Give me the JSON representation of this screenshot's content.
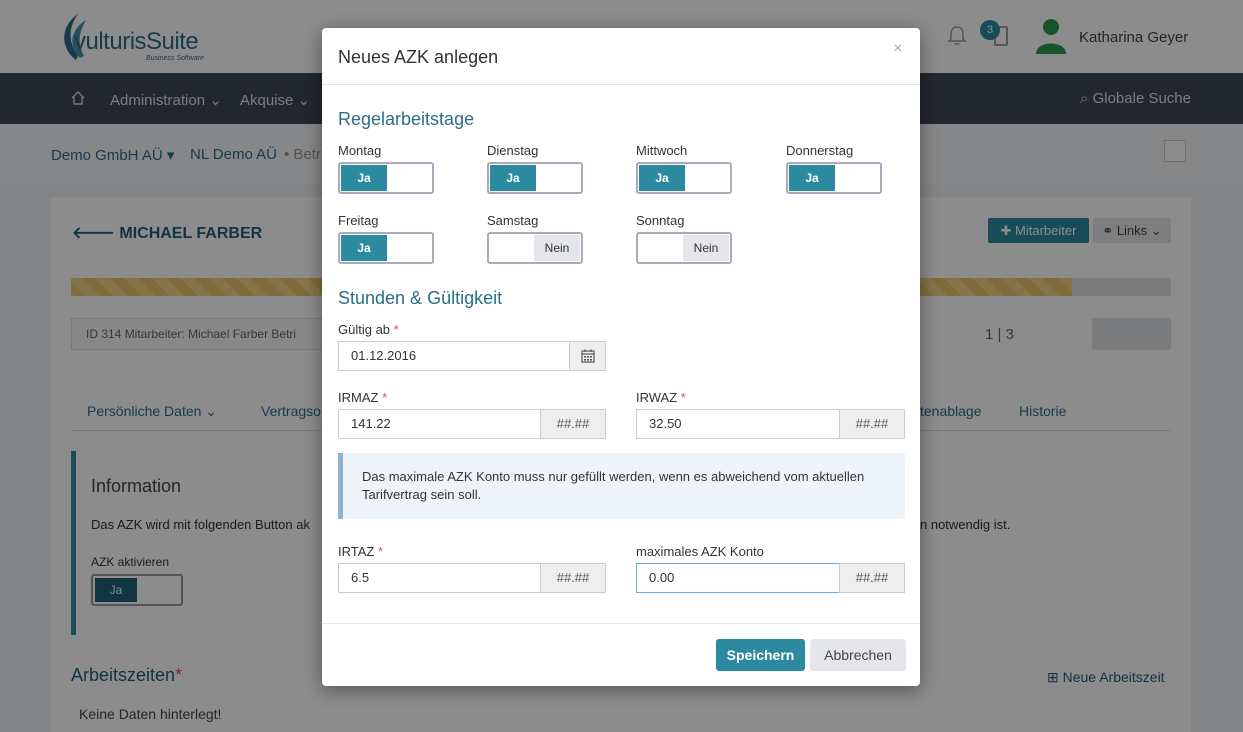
{
  "app": {
    "logo_text": "vulturisSuite",
    "logo_subtitle": "Business Software",
    "notification_count": "3",
    "user_name": "Katharina Geyer",
    "brand_color": "#2b8aa0"
  },
  "nav": {
    "items": [
      "Administration",
      "Akquise"
    ],
    "search_label": "Globale Suche"
  },
  "breadcrumb": {
    "company": "Demo GmbH AÜ",
    "branch": "NL Demo AÜ",
    "partial": "Betr"
  },
  "employee": {
    "title": "MICHAEL FARBER",
    "btn_mitarbeiter": "Mitarbeiter",
    "btn_links": "Links",
    "progress_fraction": 0.91,
    "id_strip": "ID 314 Mitarbeiter: Michael Farber Betri",
    "pager": "1 | 3"
  },
  "tabs": [
    "Persönliche Daten",
    "Vertragso",
    "tenablage",
    "Historie"
  ],
  "info": {
    "title": "Information",
    "text_left": "Das AZK wird mit folgenden Button ak",
    "text_right": "n notwendig ist.",
    "azk_label": "AZK aktivieren",
    "azk_value": "Ja"
  },
  "arbeitszeiten": {
    "title": "Arbeitszeiten",
    "add_label": "Neue Arbeitszeit",
    "empty": "Keine Daten hinterlegt!"
  },
  "modal": {
    "title": "Neues AZK anlegen",
    "close": "×",
    "section_days": "Regelarbeitstage",
    "days": [
      {
        "label": "Montag",
        "on": true,
        "on_text": "Ja",
        "off_text": ""
      },
      {
        "label": "Dienstag",
        "on": true,
        "on_text": "Ja",
        "off_text": ""
      },
      {
        "label": "Mittwoch",
        "on": true,
        "on_text": "Ja",
        "off_text": ""
      },
      {
        "label": "Donnerstag",
        "on": true,
        "on_text": "Ja",
        "off_text": ""
      },
      {
        "label": "Freitag",
        "on": true,
        "on_text": "Ja",
        "off_text": ""
      },
      {
        "label": "Samstag",
        "on": false,
        "on_text": "",
        "off_text": "Nein"
      },
      {
        "label": "Sonntag",
        "on": false,
        "on_text": "",
        "off_text": "Nein"
      }
    ],
    "section_hours": "Stunden & Gültigkeit",
    "gueltig_label": "Gültig ab",
    "gueltig_value": "01.12.2016",
    "irmaz_label": "IRMAZ",
    "irmaz_value": "141.22",
    "irwaz_label": "IRWAZ",
    "irwaz_value": "32.50",
    "addon": "##.##",
    "alert": "Das maximale AZK Konto muss nur gefüllt werden, wenn es abweichend vom aktuellen Tarifvertrag sein soll.",
    "irtaz_label": "IRTAZ",
    "irtaz_value": "6.5",
    "max_label": "maximales AZK Konto",
    "max_value": "0.00",
    "required_mark": "*",
    "save": "Speichern",
    "cancel": "Abbrechen"
  }
}
